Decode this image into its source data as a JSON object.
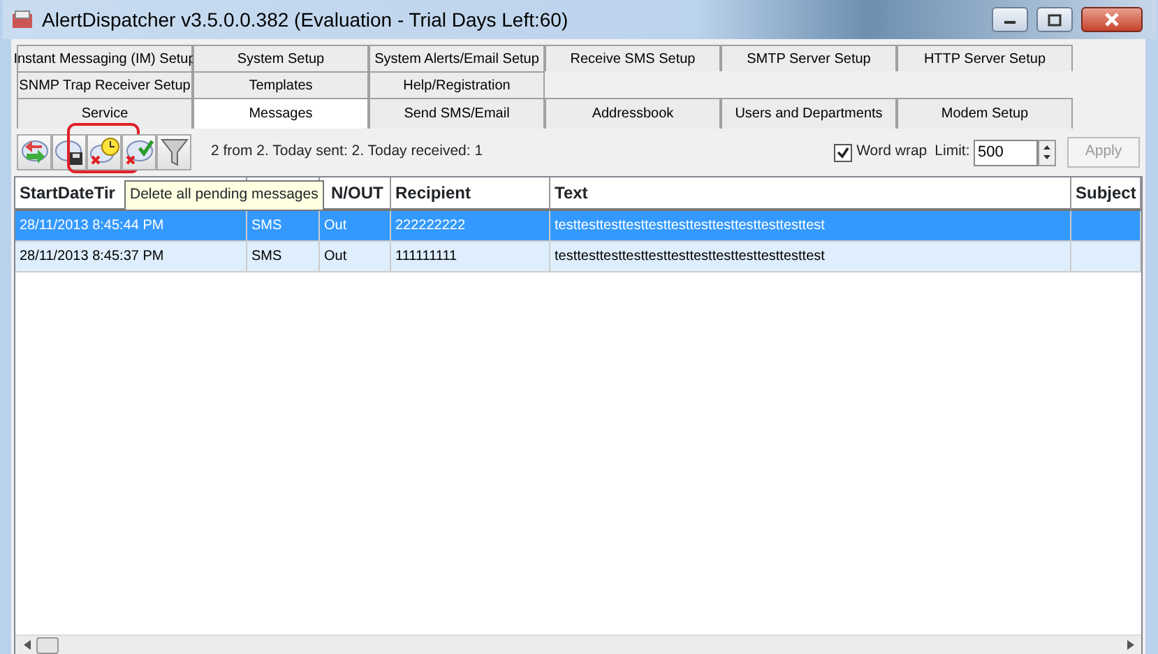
{
  "window": {
    "title": "AlertDispatcher v3.5.0.0.382 (Evaluation - Trial Days Left:60)"
  },
  "tab_rows": [
    [
      {
        "label": "Instant Messaging (IM) Setup",
        "selected": false
      },
      {
        "label": "System Setup",
        "selected": false
      },
      {
        "label": "System Alerts/Email Setup",
        "selected": false
      },
      {
        "label": "Receive SMS Setup",
        "selected": false
      },
      {
        "label": "SMTP Server Setup",
        "selected": false
      },
      {
        "label": "HTTP Server Setup",
        "selected": false
      }
    ],
    [
      {
        "label": "SNMP Trap Receiver Setup",
        "selected": false
      },
      {
        "label": "Templates",
        "selected": false
      },
      {
        "label": "Help/Registration",
        "selected": false
      }
    ],
    [
      {
        "label": "Service",
        "selected": false
      },
      {
        "label": "Messages",
        "selected": true
      },
      {
        "label": "Send SMS/Email",
        "selected": false
      },
      {
        "label": "Addressbook",
        "selected": false
      },
      {
        "label": "Users and Departments",
        "selected": false
      },
      {
        "label": "Modem Setup",
        "selected": false
      }
    ]
  ],
  "toolbar": {
    "buttons": [
      {
        "highlighted": false
      },
      {
        "highlighted": false
      },
      {
        "highlighted": true
      },
      {
        "highlighted": false
      },
      {
        "highlighted": false
      }
    ],
    "status": "2 from 2. Today sent: 2. Today received: 1",
    "word_wrap": {
      "label": "Word wrap",
      "checked": true
    },
    "limit": {
      "label": "Limit:",
      "value": "500"
    },
    "apply": {
      "label": "Apply",
      "disabled": true
    }
  },
  "tooltip": "Delete all pending messages",
  "table": {
    "columns": [
      "StartDateTir",
      "",
      "N/OUT",
      "Recipient",
      "Text",
      "Subject"
    ],
    "rows": [
      {
        "selected": true,
        "cells": [
          "28/11/2013 8:45:44 PM",
          "SMS",
          "Out",
          "222222222",
          "testtesttesttesttesttesttesttesttesttesttesttest",
          ""
        ]
      },
      {
        "selected": false,
        "cells": [
          "28/11/2013 8:45:37 PM",
          "SMS",
          "Out",
          "111111111",
          "testtesttesttesttesttesttesttesttesttesttesttest",
          ""
        ]
      }
    ]
  }
}
